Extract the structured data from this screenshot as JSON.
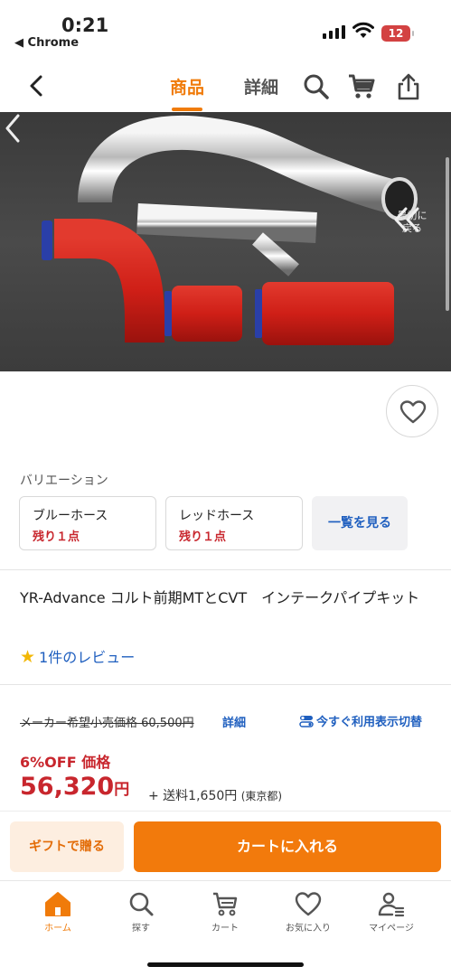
{
  "status_bar": {
    "time": "0:21",
    "back_app": "◀ Chrome",
    "battery": "12"
  },
  "nav": {
    "tabs": [
      {
        "label": "商品",
        "active": true
      },
      {
        "label": "詳細",
        "active": false
      }
    ],
    "icons": [
      "back-chevron-icon",
      "search-icon",
      "cart-icon",
      "share-icon"
    ]
  },
  "carousel": {
    "first_label_line1": "最初に",
    "first_label_line2": "戻る"
  },
  "variation": {
    "title": "バリエーション",
    "options": [
      {
        "name": "ブルーホース",
        "stock": "残り１点"
      },
      {
        "name": "レッドホース",
        "stock": "残り１点"
      }
    ],
    "view_all": "一覧を見る"
  },
  "product": {
    "title": "YR-Advance コルト前期MTとCVT　インテークパイプキット",
    "review": "1件のレビュー"
  },
  "pricing": {
    "list_price": "メーカー希望小売価格 60,500円",
    "detail_link": "詳細",
    "toggle_link": "今すぐ利用表示切替",
    "discount": "6%OFF 価格",
    "price": "56,320",
    "price_unit": "円",
    "shipping": "+ 送料1,650円",
    "shipping_region": "(東京都)"
  },
  "cta": {
    "gift": "ギフトで贈る",
    "cart": "カートに入れる"
  },
  "bottom_nav": {
    "items": [
      {
        "label": "ホーム",
        "icon": "home-icon",
        "active": true
      },
      {
        "label": "探す",
        "icon": "search-icon",
        "active": false
      },
      {
        "label": "カート",
        "icon": "cart-icon",
        "active": false
      },
      {
        "label": "お気に入り",
        "icon": "heart-icon",
        "active": false
      },
      {
        "label": "マイページ",
        "icon": "user-icon",
        "active": false
      }
    ]
  },
  "colors": {
    "accent": "#f07b0a",
    "price_red": "#c8262d",
    "link_blue": "#1f5fbf"
  }
}
